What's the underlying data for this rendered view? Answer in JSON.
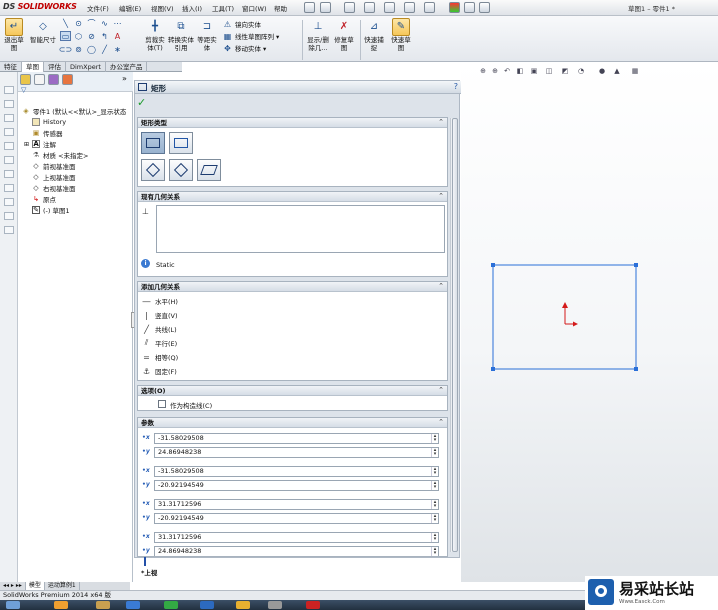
{
  "window": {
    "logo": "SOLIDWORKS",
    "logo_prefix": "DS",
    "doc_title": "草图1 – 零件1 *"
  },
  "menu": [
    "文件(F)",
    "编辑(E)",
    "视图(V)",
    "插入(I)",
    "工具(T)",
    "窗口(W)",
    "帮助"
  ],
  "ribbon": {
    "exit_sketch": "退出草图",
    "smart_dim": "智能尺寸",
    "trim": "剪裁实体(T)",
    "convert": "转换实体引用",
    "offset": "等距实体",
    "mirror": "镜向实体",
    "linear_pattern": "线性草图阵列",
    "move": "移动实体",
    "show_relations": "显示/删除几...",
    "repair": "修复草图",
    "quick_snap": "快速捕捉",
    "rapid_sketch": "快速草图"
  },
  "tabs": [
    "特征",
    "草图",
    "评估",
    "DimXpert",
    "办公室产品"
  ],
  "tree": {
    "root": "零件1 (默认<<默认>_显示状态",
    "items": [
      "History",
      "传感器",
      "注解",
      "材质 <未指定>",
      "前视基准面",
      "上视基准面",
      "右视基准面",
      "原点",
      "(-) 草图1"
    ]
  },
  "pm": {
    "title": "矩形",
    "help": "?",
    "rect_type": {
      "header": "矩形类型"
    },
    "existing": {
      "header": "现有几何关系",
      "status": "Static"
    },
    "add": {
      "header": "添加几何关系",
      "items": [
        "水平(H)",
        "竖直(V)",
        "共线(L)",
        "平行(E)",
        "相等(Q)",
        "固定(F)"
      ]
    },
    "options": {
      "header": "选项(O)",
      "construction": "作为构造线(C)"
    },
    "params": {
      "header": "参数",
      "fields": [
        "-31.58029508",
        "24.86948238",
        "-31.58029508",
        "-20.92194549",
        "31.31712596",
        "-20.92194549",
        "31.31712596",
        "24.86948238"
      ]
    }
  },
  "view_label": "*上视",
  "bottom_tabs": [
    "模型",
    "运动算例1"
  ],
  "status": "SolidWorks Premium 2014 x64 版",
  "watermark": {
    "cn": "易采站长站",
    "en": "Www.Easck.Com"
  },
  "colors": {
    "sketch": "#2a6fd8",
    "accent": "#c00000"
  }
}
